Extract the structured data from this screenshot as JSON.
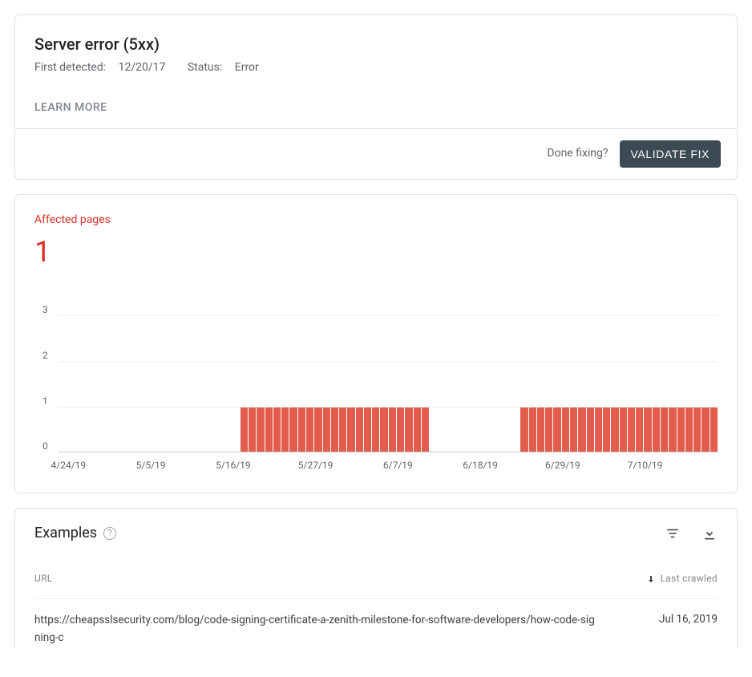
{
  "error_card": {
    "title": "Server error (5xx)",
    "first_detected_label": "First detected:",
    "first_detected_value": "12/20/17",
    "status_label": "Status:",
    "status_value": "Error",
    "learn_more": "LEARN MORE",
    "done_fixing": "Done fixing?",
    "validate_button": "VALIDATE FIX"
  },
  "affected": {
    "label": "Affected pages",
    "count": "1"
  },
  "chart_data": {
    "type": "bar",
    "title": "Affected pages",
    "xlabel": "",
    "ylabel": "",
    "ylim": [
      0,
      3
    ],
    "y_ticks": [
      0,
      1,
      2,
      3
    ],
    "x_ticks": [
      "4/24/19",
      "5/5/19",
      "5/16/19",
      "5/27/19",
      "6/7/19",
      "6/18/19",
      "6/29/19",
      "7/10/19"
    ],
    "x_tick_positions_pct": [
      1.5,
      14,
      26.5,
      39,
      51.5,
      64,
      76.5,
      89
    ],
    "values": [
      0,
      0,
      0,
      0,
      0,
      0,
      0,
      0,
      0,
      0,
      0,
      0,
      0,
      0,
      0,
      0,
      0,
      0,
      0,
      0,
      0,
      0,
      1,
      1,
      1,
      1,
      1,
      1,
      1,
      1,
      1,
      1,
      1,
      1,
      1,
      1,
      1,
      1,
      1,
      1,
      1,
      1,
      1,
      1,
      1,
      0,
      0,
      0,
      0,
      0,
      0,
      0,
      0,
      0,
      0,
      0,
      1,
      1,
      1,
      1,
      1,
      1,
      1,
      1,
      1,
      1,
      1,
      1,
      1,
      1,
      1,
      1,
      1,
      1,
      1,
      1,
      1,
      1,
      1,
      1
    ],
    "bar_color": "#e25d4e"
  },
  "examples": {
    "title": "Examples",
    "columns": {
      "url_header": "URL",
      "last_crawled_header": "Last crawled"
    },
    "rows": [
      {
        "url": "https://cheapsslsecurity.com/blog/code-signing-certificate-a-zenith-milestone-for-software-developers/how-code-signing-c",
        "last_crawled": "Jul 16, 2019"
      }
    ]
  }
}
